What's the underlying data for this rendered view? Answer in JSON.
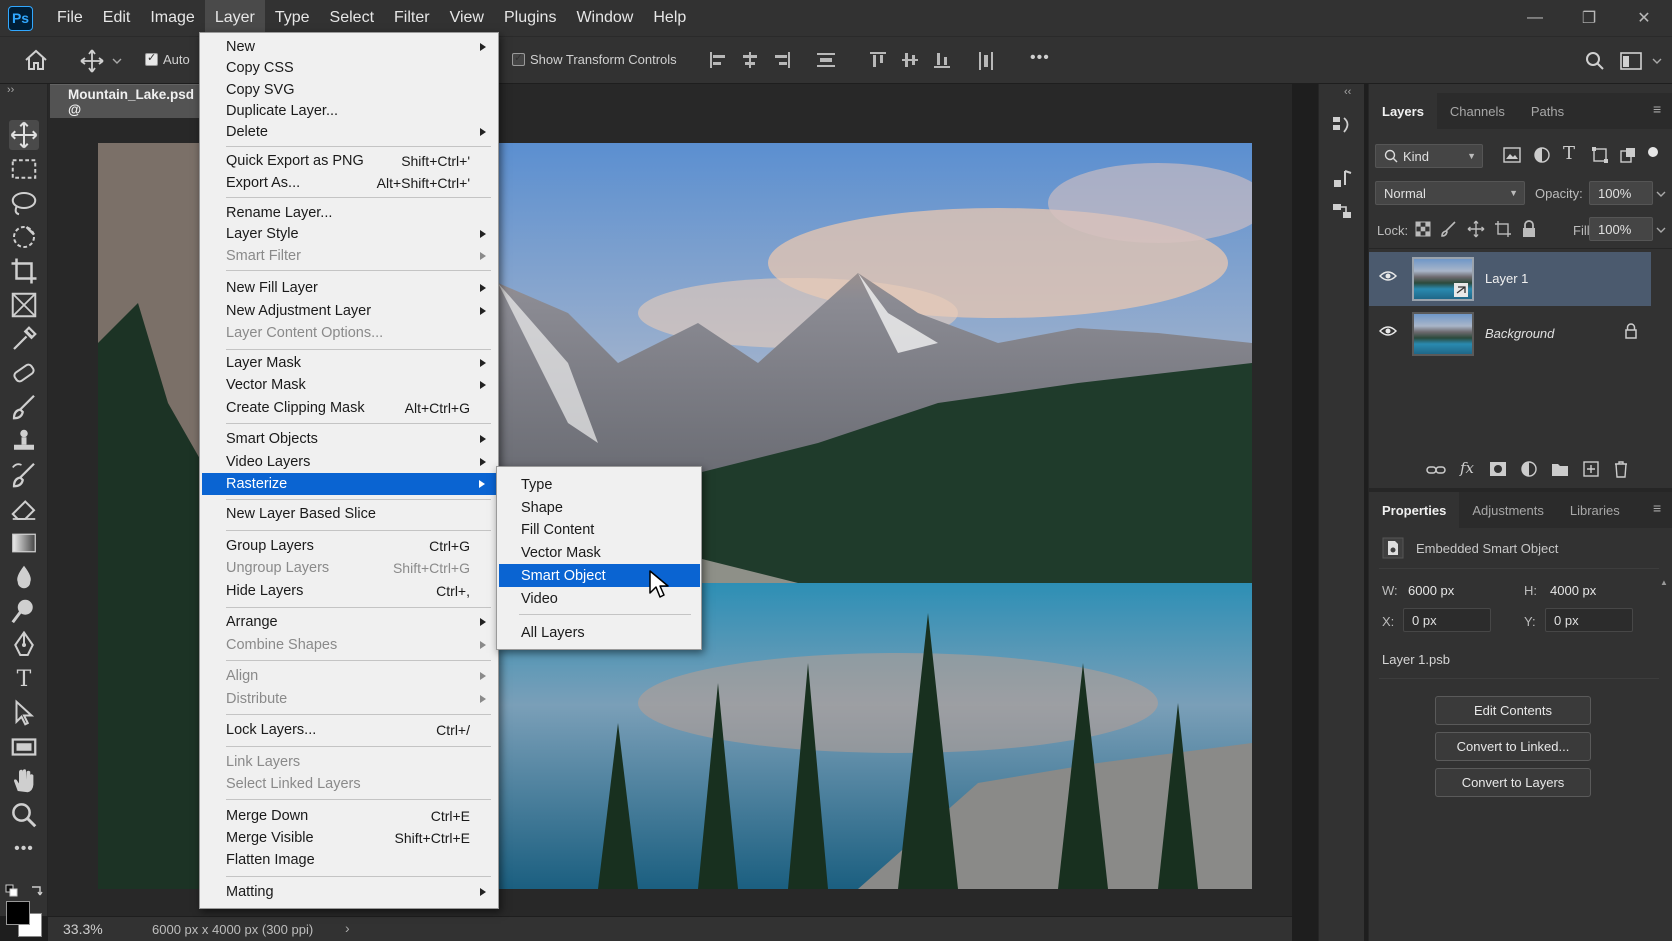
{
  "app": {
    "logo": "Ps"
  },
  "menubar": {
    "items": [
      "File",
      "Edit",
      "Image",
      "Layer",
      "Type",
      "Select",
      "Filter",
      "View",
      "Plugins",
      "Window",
      "Help"
    ],
    "active": "Layer"
  },
  "window_controls": {
    "minimize": "—",
    "restore": "❐",
    "close": "✕"
  },
  "options_bar": {
    "auto_select_label": "Auto",
    "show_transform_controls": "Show Transform Controls",
    "more_label": "•••"
  },
  "document": {
    "tab_title": "Mountain_Lake.psd @",
    "zoom": "33.3%",
    "doc_info": "6000 px x 4000 px (300 ppi)",
    "status_arrow": "›"
  },
  "layer_menu": {
    "items": [
      {
        "label": "New",
        "shortcut": "",
        "submenu": true,
        "disabled": false
      },
      {
        "label": "Copy CSS",
        "shortcut": "",
        "submenu": false,
        "disabled": false
      },
      {
        "label": "Copy SVG",
        "shortcut": "",
        "submenu": false,
        "disabled": false
      },
      {
        "label": "Duplicate Layer...",
        "shortcut": "",
        "submenu": false,
        "disabled": false
      },
      {
        "label": "Delete",
        "shortcut": "",
        "submenu": true,
        "disabled": false
      },
      {
        "label": "Quick Export as PNG",
        "shortcut": "Shift+Ctrl+'",
        "submenu": false,
        "disabled": false
      },
      {
        "label": "Export As...",
        "shortcut": "Alt+Shift+Ctrl+'",
        "submenu": false,
        "disabled": false
      },
      {
        "label": "Rename Layer...",
        "shortcut": "",
        "submenu": false,
        "disabled": false
      },
      {
        "label": "Layer Style",
        "shortcut": "",
        "submenu": true,
        "disabled": false
      },
      {
        "label": "Smart Filter",
        "shortcut": "",
        "submenu": true,
        "disabled": true
      },
      {
        "label": "New Fill Layer",
        "shortcut": "",
        "submenu": true,
        "disabled": false
      },
      {
        "label": "New Adjustment Layer",
        "shortcut": "",
        "submenu": true,
        "disabled": false
      },
      {
        "label": "Layer Content Options...",
        "shortcut": "",
        "submenu": false,
        "disabled": true
      },
      {
        "label": "Layer Mask",
        "shortcut": "",
        "submenu": true,
        "disabled": false
      },
      {
        "label": "Vector Mask",
        "shortcut": "",
        "submenu": true,
        "disabled": false
      },
      {
        "label": "Create Clipping Mask",
        "shortcut": "Alt+Ctrl+G",
        "submenu": false,
        "disabled": false
      },
      {
        "label": "Smart Objects",
        "shortcut": "",
        "submenu": true,
        "disabled": false
      },
      {
        "label": "Video Layers",
        "shortcut": "",
        "submenu": true,
        "disabled": false
      },
      {
        "label": "Rasterize",
        "shortcut": "",
        "submenu": true,
        "disabled": false,
        "highlighted": true
      },
      {
        "label": "New Layer Based Slice",
        "shortcut": "",
        "submenu": false,
        "disabled": false
      },
      {
        "label": "Group Layers",
        "shortcut": "Ctrl+G",
        "submenu": false,
        "disabled": false
      },
      {
        "label": "Ungroup Layers",
        "shortcut": "Shift+Ctrl+G",
        "submenu": false,
        "disabled": true
      },
      {
        "label": "Hide Layers",
        "shortcut": "Ctrl+,",
        "submenu": false,
        "disabled": false
      },
      {
        "label": "Arrange",
        "shortcut": "",
        "submenu": true,
        "disabled": false
      },
      {
        "label": "Combine Shapes",
        "shortcut": "",
        "submenu": true,
        "disabled": true
      },
      {
        "label": "Align",
        "shortcut": "",
        "submenu": true,
        "disabled": true
      },
      {
        "label": "Distribute",
        "shortcut": "",
        "submenu": true,
        "disabled": true
      },
      {
        "label": "Lock Layers...",
        "shortcut": "Ctrl+/",
        "submenu": false,
        "disabled": false
      },
      {
        "label": "Link Layers",
        "shortcut": "",
        "submenu": false,
        "disabled": true
      },
      {
        "label": "Select Linked Layers",
        "shortcut": "",
        "submenu": false,
        "disabled": true
      },
      {
        "label": "Merge Down",
        "shortcut": "Ctrl+E",
        "submenu": false,
        "disabled": false
      },
      {
        "label": "Merge Visible",
        "shortcut": "Shift+Ctrl+E",
        "submenu": false,
        "disabled": false
      },
      {
        "label": "Flatten Image",
        "shortcut": "",
        "submenu": false,
        "disabled": false
      },
      {
        "label": "Matting",
        "shortcut": "",
        "submenu": true,
        "disabled": false
      }
    ]
  },
  "rasterize_submenu": {
    "items": [
      {
        "label": "Type"
      },
      {
        "label": "Shape"
      },
      {
        "label": "Fill Content"
      },
      {
        "label": "Vector Mask"
      },
      {
        "label": "Smart Object",
        "highlighted": true
      },
      {
        "label": "Video"
      },
      {
        "label": "All Layers"
      }
    ]
  },
  "layers_panel": {
    "tabs": [
      "Layers",
      "Channels",
      "Paths"
    ],
    "active_tab": "Layers",
    "filter_kind": "Kind",
    "blend_mode": "Normal",
    "opacity_label": "Opacity:",
    "opacity_value": "100%",
    "lock_label": "Lock:",
    "fill_label": "Fill:",
    "fill_value": "100%",
    "layers": [
      {
        "name": "Layer 1",
        "selected": true,
        "visible": true
      },
      {
        "name": "Background",
        "selected": false,
        "visible": true,
        "locked": true
      }
    ]
  },
  "properties_panel": {
    "tabs": [
      "Properties",
      "Adjustments",
      "Libraries"
    ],
    "active_tab": "Properties",
    "object_type": "Embedded Smart Object",
    "w_label": "W:",
    "w_value": "6000 px",
    "h_label": "H:",
    "h_value": "4000 px",
    "x_label": "X:",
    "x_value": "0 px",
    "y_label": "Y:",
    "y_value": "0 px",
    "filename": "Layer 1.psb",
    "buttons": [
      "Edit Contents",
      "Convert to Linked...",
      "Convert to Layers"
    ]
  },
  "colors": {
    "menu_highlight": "#0a64d2",
    "panel_bg": "#323232",
    "canvas_bg": "#282828",
    "selected_layer": "#4b5a6e"
  }
}
